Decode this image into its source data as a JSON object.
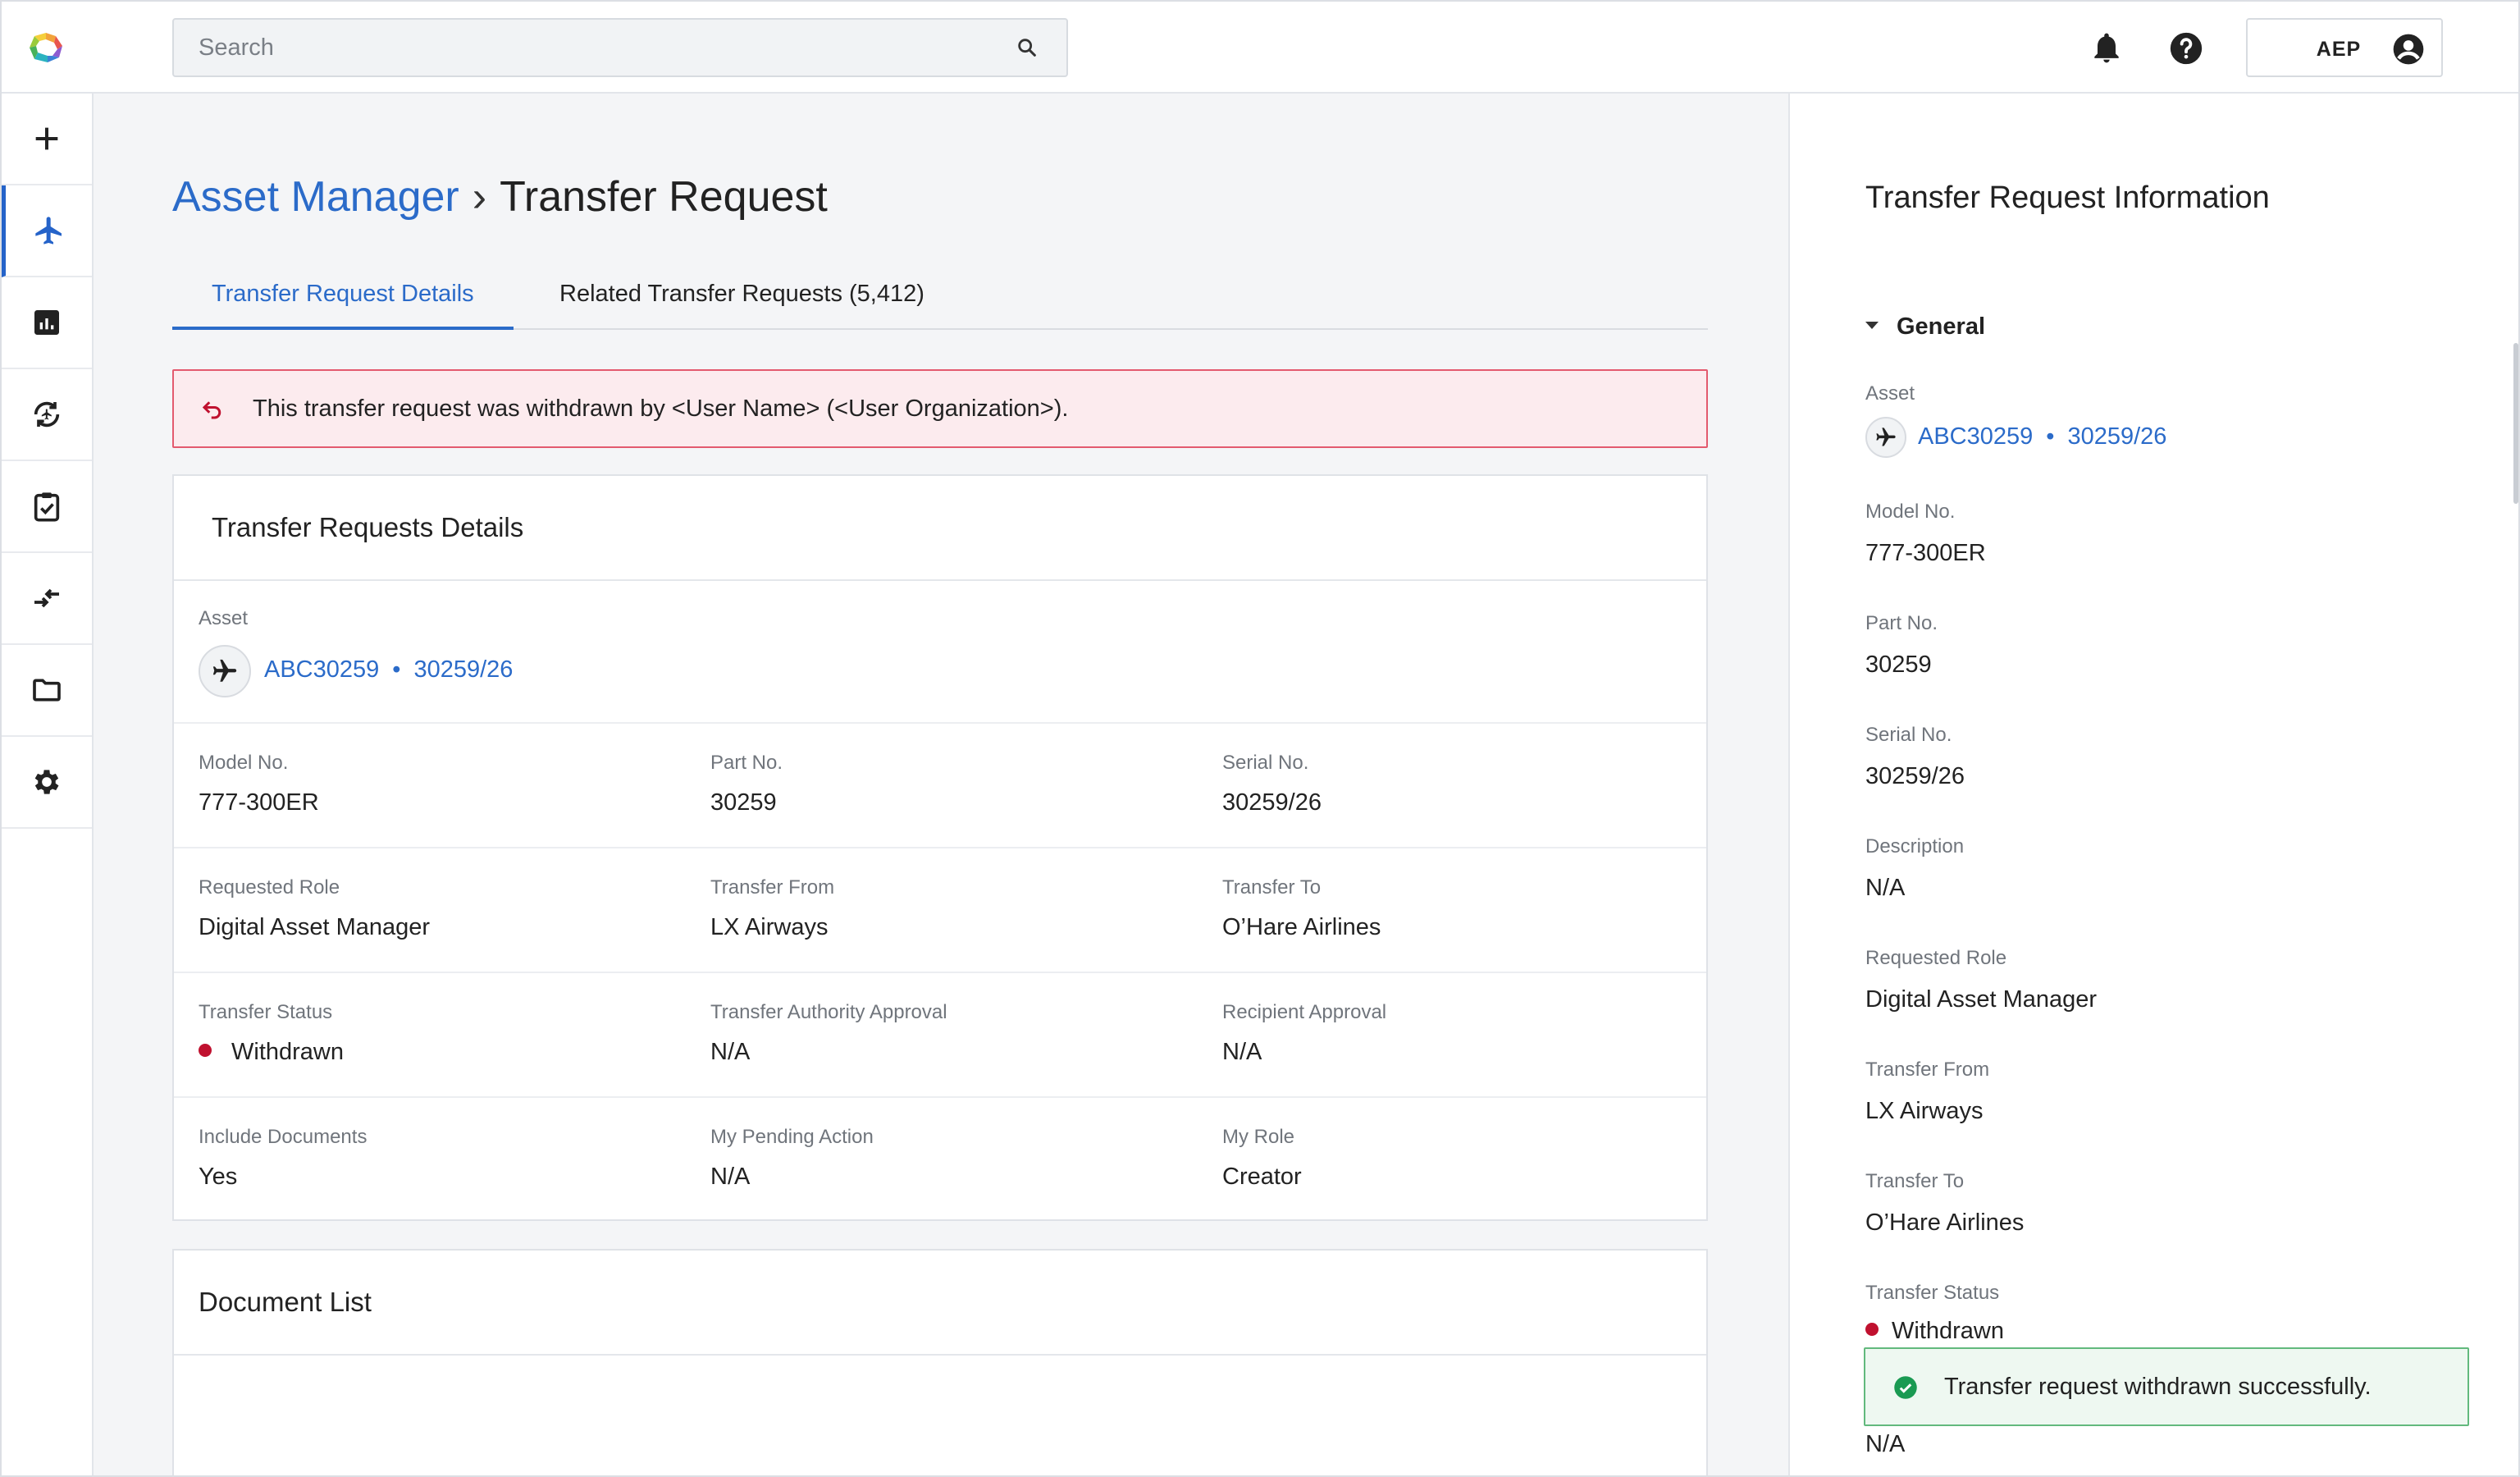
{
  "search": {
    "placeholder": "Search"
  },
  "header": {
    "org_label": "AEP"
  },
  "sidebar": {
    "items": [
      {
        "icon": "plus-icon"
      },
      {
        "icon": "airplane-icon",
        "active": true
      },
      {
        "icon": "analytics-icon"
      },
      {
        "icon": "transfer-sync-icon"
      },
      {
        "icon": "clipboard-check-icon"
      },
      {
        "icon": "swap-arrows-icon"
      },
      {
        "icon": "folder-icon"
      },
      {
        "icon": "settings-icon"
      }
    ]
  },
  "breadcrumb": {
    "parent": "Asset Manager",
    "separator": "›",
    "current": "Transfer Request"
  },
  "tabs": [
    {
      "label": "Transfer Request Details",
      "active": true
    },
    {
      "label": "Related Transfer Requests (5,412)",
      "active": false
    }
  ],
  "alert": {
    "text": "This transfer request was withdrawn by <User Name> (<User Organization>)."
  },
  "details": {
    "title": "Transfer Requests Details",
    "asset_label": "Asset",
    "asset_id": "ABC30259",
    "asset_dot": "•",
    "asset_serial": "30259/26",
    "rows": [
      [
        {
          "label": "Model No.",
          "value": "777-300ER"
        },
        {
          "label": "Part No.",
          "value": "30259"
        },
        {
          "label": "Serial No.",
          "value": "30259/26"
        }
      ],
      [
        {
          "label": "Requested Role",
          "value": "Digital Asset Manager"
        },
        {
          "label": "Transfer From",
          "value": "LX Airways"
        },
        {
          "label": "Transfer To",
          "value": "O’Hare Airlines"
        }
      ],
      [
        {
          "label": "Transfer Status",
          "value": "Withdrawn"
        },
        {
          "label": "Transfer Authority Approval",
          "value": "N/A"
        },
        {
          "label": "Recipient Approval",
          "value": "N/A"
        }
      ],
      [
        {
          "label": "Include Documents",
          "value": "Yes"
        },
        {
          "label": "My Pending Action",
          "value": "N/A"
        },
        {
          "label": "My Role",
          "value": "Creator"
        }
      ]
    ],
    "status_color": "#c0112f"
  },
  "documents": {
    "title": "Document List"
  },
  "panel": {
    "title": "Transfer Request Information",
    "section": "General",
    "asset_label": "Asset",
    "asset_id": "ABC30259",
    "asset_dot": "•",
    "asset_serial": "30259/26",
    "fields": [
      {
        "label": "Model No.",
        "value": "777-300ER"
      },
      {
        "label": "Part No.",
        "value": "30259"
      },
      {
        "label": "Serial No.",
        "value": "30259/26"
      },
      {
        "label": "Description",
        "value": "N/A"
      },
      {
        "label": "Requested Role",
        "value": "Digital Asset Manager"
      },
      {
        "label": "Transfer From",
        "value": "LX Airways"
      },
      {
        "label": "Transfer To",
        "value": "O’Hare Airlines"
      },
      {
        "label": "Transfer Status",
        "value": "Withdrawn"
      }
    ],
    "trailing_value": "N/A"
  },
  "toast": {
    "text": "Transfer request withdrawn successfully."
  },
  "colors": {
    "accent": "#2b6bc9",
    "error": "#c0112f",
    "success": "#1a9a52"
  }
}
